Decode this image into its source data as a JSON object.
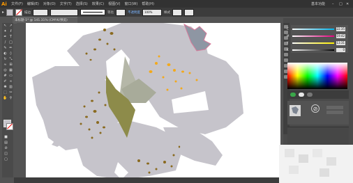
{
  "app": {
    "logo": "Ai"
  },
  "menu": {
    "items": [
      "文件(F)",
      "编辑(E)",
      "对象(O)",
      "文字(T)",
      "选择(S)",
      "效果(C)",
      "视图(V)",
      "窗口(W)",
      "帮助(H)"
    ],
    "workspace": "基本功能"
  },
  "control_bar": {
    "stroke_label": "描边",
    "stroke_weight": "",
    "variable_width": "等比",
    "style_label": "基本",
    "opacity_label": "不透明度",
    "opacity_value": "100%",
    "style2_label": "样式"
  },
  "document": {
    "tab_title": "未标题-1* @ 141.31% (CMYK/预览)"
  },
  "color_panel": {
    "labels": [
      "C",
      "M",
      "Y",
      "K"
    ],
    "values": [
      "22.35",
      "19.42",
      "13.31",
      "0"
    ],
    "slider_colors": [
      "#00b6ef",
      "#e5007e",
      "#fff100",
      "#000000"
    ]
  },
  "swatch_panel": {
    "button_1": "",
    "button_2": ""
  },
  "colors": {
    "petal": "#c6c4cb",
    "dots_brown": "#8a6a1f",
    "dots_orange": "#f3a91b",
    "stamen_olive": "#8d8b4a",
    "stamen_gray": "#b5b7a8",
    "accent_pink": "#d87a9a"
  }
}
